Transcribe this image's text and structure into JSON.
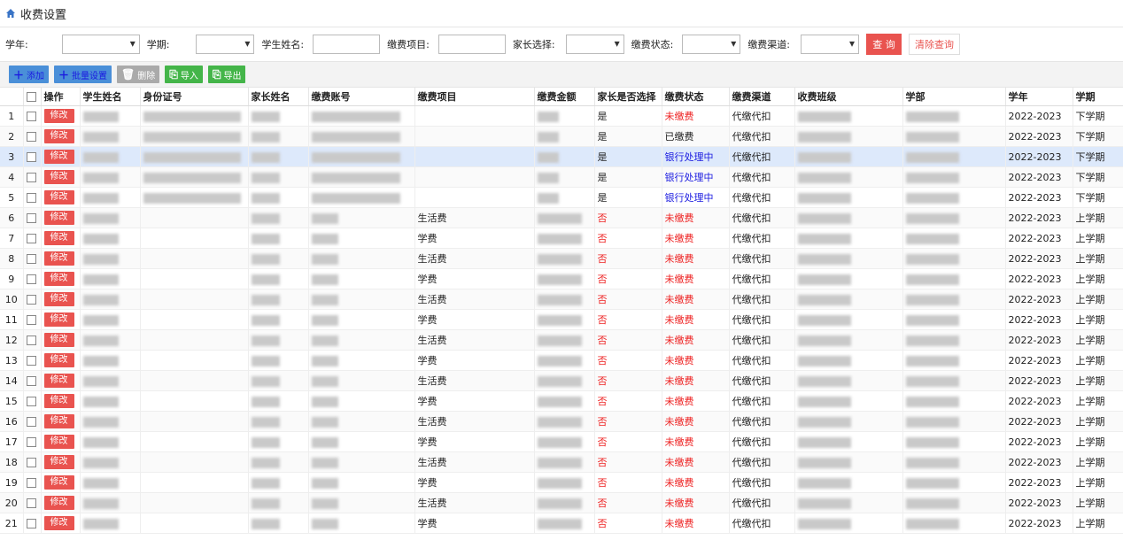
{
  "page_title": "收费设置",
  "filters": {
    "year_label": "学年:",
    "term_label": "学期:",
    "student_name_label": "学生姓名:",
    "fee_item_label": "缴费项目:",
    "parent_select_label": "家长选择:",
    "status_label": "缴费状态:",
    "channel_label": "缴费渠道:",
    "query_button": "查 询",
    "clear_button": "清除查询"
  },
  "toolbar": {
    "add": "添加",
    "batch": "批量设置",
    "delete": "删除",
    "import": "导入",
    "export": "导出"
  },
  "columns": [
    "操作",
    "学生姓名",
    "身份证号",
    "家长姓名",
    "缴费账号",
    "缴费项目",
    "缴费金额",
    "家长是否选择",
    "缴费状态",
    "缴费渠道",
    "收费班级",
    "学部",
    "学年",
    "学期"
  ],
  "edit_label": "修改",
  "rows": [
    {
      "n": "1",
      "item": "",
      "chosen": "是",
      "status": "未缴费",
      "st": "red",
      "ch": "代缴代扣",
      "year": "2022-2023",
      "term": "下学期"
    },
    {
      "n": "2",
      "item": "",
      "chosen": "是",
      "status": "已缴费",
      "st": "",
      "ch": "代缴代扣",
      "year": "2022-2023",
      "term": "下学期"
    },
    {
      "n": "3",
      "item": "",
      "chosen": "是",
      "status": "银行处理中",
      "st": "blue",
      "ch": "代缴代扣",
      "year": "2022-2023",
      "term": "下学期"
    },
    {
      "n": "4",
      "item": "",
      "chosen": "是",
      "status": "银行处理中",
      "st": "blue",
      "ch": "代缴代扣",
      "year": "2022-2023",
      "term": "下学期"
    },
    {
      "n": "5",
      "item": "",
      "chosen": "是",
      "status": "银行处理中",
      "st": "blue",
      "ch": "代缴代扣",
      "year": "2022-2023",
      "term": "下学期"
    },
    {
      "n": "6",
      "item": "生活费",
      "chosen": "否",
      "status": "未缴费",
      "st": "red",
      "ch": "代缴代扣",
      "year": "2022-2023",
      "term": "上学期"
    },
    {
      "n": "7",
      "item": "学费",
      "chosen": "否",
      "status": "未缴费",
      "st": "red",
      "ch": "代缴代扣",
      "year": "2022-2023",
      "term": "上学期"
    },
    {
      "n": "8",
      "item": "生活费",
      "chosen": "否",
      "status": "未缴费",
      "st": "red",
      "ch": "代缴代扣",
      "year": "2022-2023",
      "term": "上学期"
    },
    {
      "n": "9",
      "item": "学费",
      "chosen": "否",
      "status": "未缴费",
      "st": "red",
      "ch": "代缴代扣",
      "year": "2022-2023",
      "term": "上学期"
    },
    {
      "n": "10",
      "item": "生活费",
      "chosen": "否",
      "status": "未缴费",
      "st": "red",
      "ch": "代缴代扣",
      "year": "2022-2023",
      "term": "上学期"
    },
    {
      "n": "11",
      "item": "学费",
      "chosen": "否",
      "status": "未缴费",
      "st": "red",
      "ch": "代缴代扣",
      "year": "2022-2023",
      "term": "上学期"
    },
    {
      "n": "12",
      "item": "生活费",
      "chosen": "否",
      "status": "未缴费",
      "st": "red",
      "ch": "代缴代扣",
      "year": "2022-2023",
      "term": "上学期"
    },
    {
      "n": "13",
      "item": "学费",
      "chosen": "否",
      "status": "未缴费",
      "st": "red",
      "ch": "代缴代扣",
      "year": "2022-2023",
      "term": "上学期"
    },
    {
      "n": "14",
      "item": "生活费",
      "chosen": "否",
      "status": "未缴费",
      "st": "red",
      "ch": "代缴代扣",
      "year": "2022-2023",
      "term": "上学期"
    },
    {
      "n": "15",
      "item": "学费",
      "chosen": "否",
      "status": "未缴费",
      "st": "red",
      "ch": "代缴代扣",
      "year": "2022-2023",
      "term": "上学期"
    },
    {
      "n": "16",
      "item": "生活费",
      "chosen": "否",
      "status": "未缴费",
      "st": "red",
      "ch": "代缴代扣",
      "year": "2022-2023",
      "term": "上学期"
    },
    {
      "n": "17",
      "item": "学费",
      "chosen": "否",
      "status": "未缴费",
      "st": "red",
      "ch": "代缴代扣",
      "year": "2022-2023",
      "term": "上学期"
    },
    {
      "n": "18",
      "item": "生活费",
      "chosen": "否",
      "status": "未缴费",
      "st": "red",
      "ch": "代缴代扣",
      "year": "2022-2023",
      "term": "上学期"
    },
    {
      "n": "19",
      "item": "学费",
      "chosen": "否",
      "status": "未缴费",
      "st": "red",
      "ch": "代缴代扣",
      "year": "2022-2023",
      "term": "上学期"
    },
    {
      "n": "20",
      "item": "生活费",
      "chosen": "否",
      "status": "未缴费",
      "st": "red",
      "ch": "代缴代扣",
      "year": "2022-2023",
      "term": "上学期"
    },
    {
      "n": "21",
      "item": "学费",
      "chosen": "否",
      "status": "未缴费",
      "st": "red",
      "ch": "代缴代扣",
      "year": "2022-2023",
      "term": "上学期"
    }
  ]
}
